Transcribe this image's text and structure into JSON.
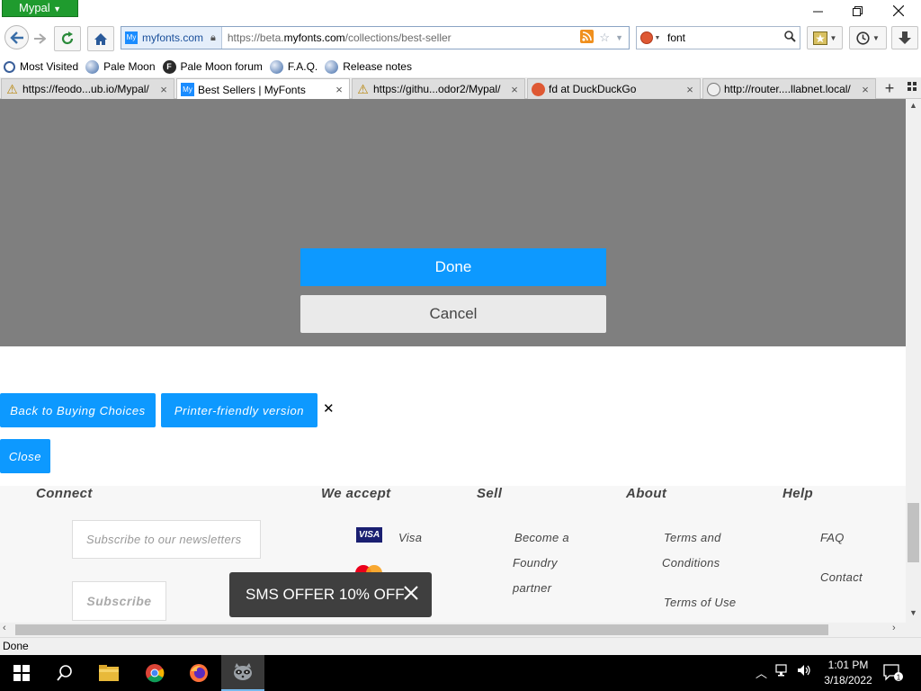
{
  "browser": {
    "app_menu_label": "Mypal",
    "url_identity": "myfonts.com",
    "url_prefix": "https://beta.",
    "url_host": "myfonts.com",
    "url_path": "/collections/best-seller",
    "search_value": "font",
    "bookmarks": [
      {
        "label": "Most Visited"
      },
      {
        "label": "Pale Moon"
      },
      {
        "label": "Pale Moon forum"
      },
      {
        "label": "F.A.Q."
      },
      {
        "label": "Release notes"
      }
    ],
    "tabs": [
      {
        "title": "https://feodo...ub.io/Mypal/",
        "icon": "warning-icon"
      },
      {
        "title": "Best Sellers | MyFonts",
        "icon": "myfonts-icon",
        "active": true
      },
      {
        "title": "https://githu...odor2/Mypal/",
        "icon": "warning-icon"
      },
      {
        "title": "fd at DuckDuckGo",
        "icon": "duckduckgo-icon"
      },
      {
        "title": "http://router....llabnet.local/",
        "icon": "globe-icon"
      }
    ],
    "status_text": "Done"
  },
  "page": {
    "dialog": {
      "done_label": "Done",
      "cancel_label": "Cancel"
    },
    "actions": {
      "back_to_buying_label": "Back to Buying Choices",
      "printer_friendly_label": "Printer-friendly version",
      "close_label": "Close"
    },
    "footer": {
      "connect_heading": "Connect",
      "newsletter_placeholder": "Subscribe to our newsletters",
      "subscribe_label": "Subscribe",
      "accept_heading": "We accept",
      "visa_label": "Visa",
      "visa_badge": "VISA",
      "sell_heading": "Sell",
      "sell_links": [
        "Become a",
        "Foundry",
        "partner"
      ],
      "about_heading": "About",
      "about_links": [
        "Terms and",
        "Conditions",
        "Terms of Use"
      ],
      "help_heading": "Help",
      "help_links": [
        "FAQ",
        "Contact"
      ]
    },
    "sms_popup_text": "SMS OFFER 10% OFF"
  },
  "taskbar": {
    "time": "1:01 PM",
    "date": "3/18/2022",
    "notification_count": "1"
  },
  "colors": {
    "accent_blue": "#0d99ff",
    "overlay_gray": "#7f7f7f",
    "popup_dark": "#3f3f3f",
    "menu_green": "#1f9b2e"
  }
}
